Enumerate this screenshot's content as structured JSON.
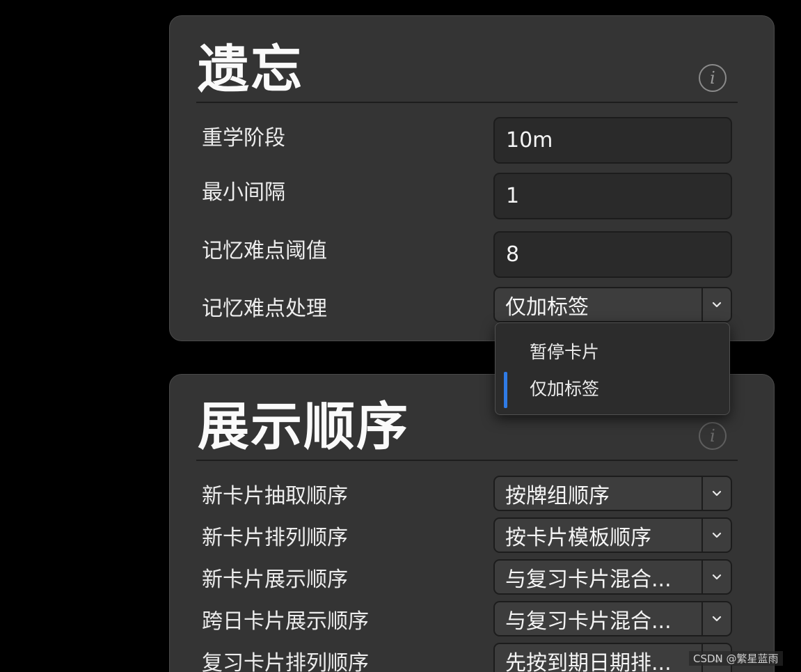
{
  "lapses": {
    "title": "遗忘",
    "info_symbol": "i",
    "relearning_steps": {
      "label": "重学阶段",
      "value": "10m"
    },
    "minimum_interval": {
      "label": "最小间隔",
      "value": "1"
    },
    "leech_threshold": {
      "label": "记忆难点阈值",
      "value": "8"
    },
    "leech_action": {
      "label": "记忆难点处理",
      "selected": "仅加标签",
      "options": [
        "暂停卡片",
        "仅加标签"
      ]
    }
  },
  "display_order": {
    "title": "展示顺序",
    "info_symbol": "i",
    "rows": [
      {
        "label": "新卡片抽取顺序",
        "selected": "按牌组顺序"
      },
      {
        "label": "新卡片排列顺序",
        "selected": "按卡片模板顺序"
      },
      {
        "label": "新卡片展示顺序",
        "selected": "与复习卡片混合..."
      },
      {
        "label": "跨日卡片展示顺序",
        "selected": "与复习卡片混合..."
      },
      {
        "label": "复习卡片排列顺序",
        "selected": "先按到期日期排..."
      }
    ]
  },
  "watermark": "CSDN @繁星蓝雨",
  "colors": {
    "card_bg": "#343434",
    "accent": "#2f7be6",
    "page_bg": "#000000"
  }
}
